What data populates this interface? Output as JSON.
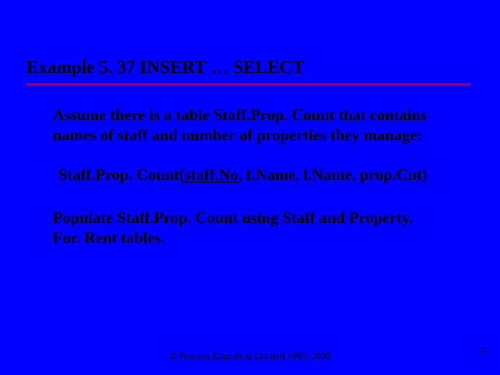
{
  "title": "Example 5. 37  INSERT … SELECT",
  "para1": "Assume there is a table Staff.Prop. Count that contains names of staff and number of properties they manage:",
  "schema_prefix": "Staff.Prop. Count(",
  "schema_pk": "staff.No",
  "schema_rest": ", f.Name, l.Name, prop.Cnt)",
  "para2": "Populate Staff.Prop. Count using Staff and Property. For. Rent tables.",
  "footer": "© Pearson Education Limited 1995, 2005",
  "pagenum": "121"
}
